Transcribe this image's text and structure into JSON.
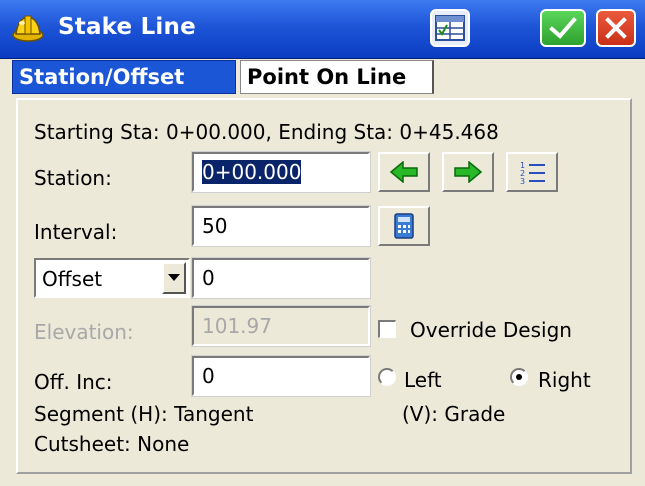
{
  "window": {
    "title": "Stake Line",
    "icons": {
      "app": "hardhat-icon",
      "table": "table-view-icon",
      "ok": "check-icon",
      "close": "close-icon"
    },
    "colors": {
      "titlebar": "#1E55D8",
      "ok": "#3CB43C",
      "close": "#D73A22",
      "tab_active": "#1A56D6"
    }
  },
  "tabs": [
    {
      "label": "Station/Offset",
      "active": true
    },
    {
      "label": "Point On Line",
      "active": false
    }
  ],
  "form": {
    "range_text": "Starting Sta: 0+00.000, Ending Sta: 0+45.468",
    "station": {
      "label": "Station:",
      "value": "0+00.000"
    },
    "interval": {
      "label": "Interval:",
      "value": "50"
    },
    "offset": {
      "selected": "Offset",
      "value": "0"
    },
    "elevation": {
      "label": "Elevation:",
      "value": "101.97"
    },
    "override_design": {
      "label": "Override Design",
      "checked": false
    },
    "off_inc": {
      "label": "Off. Inc:",
      "value": "0"
    },
    "side": {
      "left_label": "Left",
      "right_label": "Right",
      "selected": "Right"
    },
    "segment_h": "Segment (H): Tangent",
    "segment_v": "(V): Grade",
    "cutsheet": "Cutsheet: None"
  },
  "buttons": {
    "prev": "arrow-left-icon",
    "next": "arrow-right-icon",
    "list": "list-icon",
    "calc": "calculator-icon"
  }
}
